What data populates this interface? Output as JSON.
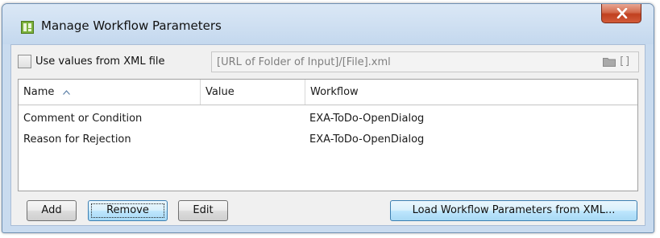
{
  "window": {
    "title": "Manage Workflow Parameters",
    "icon": "app-icon",
    "close_icon": "close-icon"
  },
  "xml_source": {
    "checkbox_label": "Use values from XML file",
    "checked": false,
    "path_value": "[URL of Folder of Input]/[File].xml",
    "folder_icon": "folder-icon",
    "bracket_icon": "[]"
  },
  "table": {
    "columns": {
      "name": "Name",
      "value": "Value",
      "workflow": "Workflow"
    },
    "sort_column": "Name",
    "sort_direction": "ascending",
    "rows": [
      {
        "name": "Comment or Condition",
        "value": "",
        "workflow": "EXA-ToDo-OpenDialog"
      },
      {
        "name": "Reason for Rejection",
        "value": "",
        "workflow": "EXA-ToDo-OpenDialog"
      }
    ]
  },
  "buttons": {
    "add": "Add",
    "remove": "Remove",
    "edit": "Edit",
    "load_xml": "Load Workflow Parameters from XML..."
  },
  "colors": {
    "title_bar": "#c9dbef",
    "close_button": "#c7472a",
    "focus_button": "#bee6fd"
  }
}
